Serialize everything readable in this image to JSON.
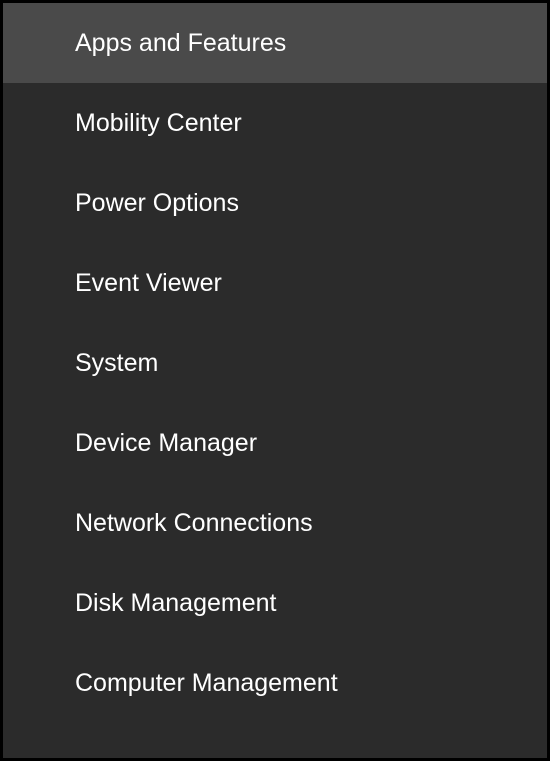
{
  "menu": {
    "items": [
      {
        "label": "Apps and Features"
      },
      {
        "label": "Mobility Center"
      },
      {
        "label": "Power Options"
      },
      {
        "label": "Event Viewer"
      },
      {
        "label": "System"
      },
      {
        "label": "Device Manager"
      },
      {
        "label": "Network Connections"
      },
      {
        "label": "Disk Management"
      },
      {
        "label": "Computer Management"
      }
    ],
    "hovered_index": 0
  }
}
